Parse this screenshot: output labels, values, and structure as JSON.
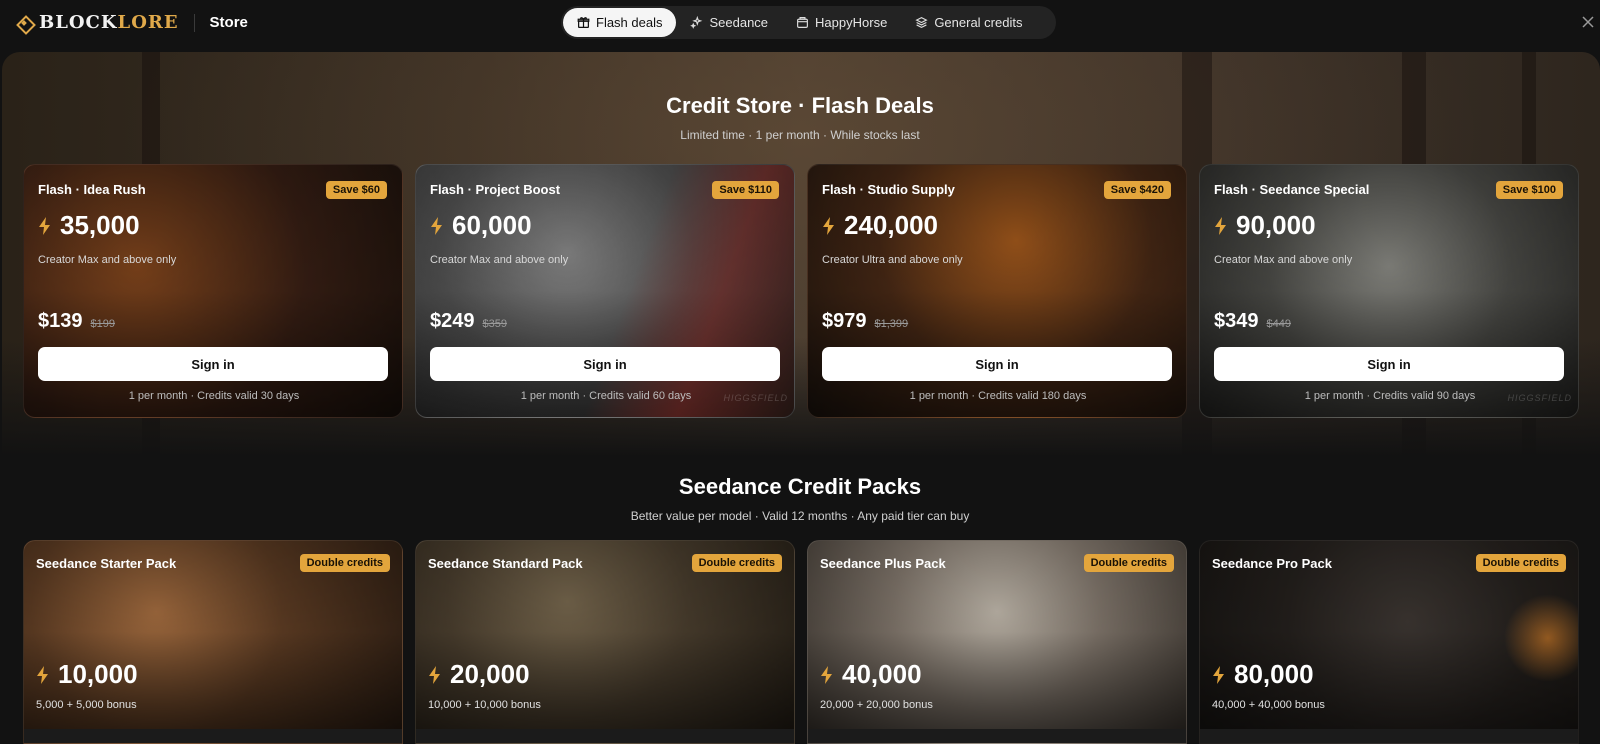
{
  "header": {
    "logo_part1": "BLOCK",
    "logo_part2": "LORE",
    "section": "Store",
    "tabs": [
      {
        "label": "Flash deals",
        "icon": "gift-icon",
        "active": true
      },
      {
        "label": "Seedance",
        "icon": "sparkle-icon",
        "active": false
      },
      {
        "label": "HappyHorse",
        "icon": "box-icon",
        "active": false
      },
      {
        "label": "General credits",
        "icon": "layers-icon",
        "active": false
      }
    ]
  },
  "flash_section": {
    "title": "Credit Store · Flash Deals",
    "subtitle": "Limited time · 1 per month · While stocks last",
    "cards": [
      {
        "name": "Flash · Idea Rush",
        "badge": "Save $60",
        "credits": "35,000",
        "eligibility": "Creator Max and above only",
        "price": "$139",
        "old_price": "$199",
        "button": "Sign in",
        "terms": "1 per month · Credits valid 30 days",
        "watermark": ""
      },
      {
        "name": "Flash · Project Boost",
        "badge": "Save $110",
        "credits": "60,000",
        "eligibility": "Creator Max and above only",
        "price": "$249",
        "old_price": "$359",
        "button": "Sign in",
        "terms": "1 per month · Credits valid 60 days",
        "watermark": "HIGGSFIELD"
      },
      {
        "name": "Flash · Studio Supply",
        "badge": "Save $420",
        "credits": "240,000",
        "eligibility": "Creator Ultra and above only",
        "price": "$979",
        "old_price": "$1,399",
        "button": "Sign in",
        "terms": "1 per month · Credits valid 180 days",
        "watermark": ""
      },
      {
        "name": "Flash · Seedance Special",
        "badge": "Save $100",
        "credits": "90,000",
        "eligibility": "Creator Max and above only",
        "price": "$349",
        "old_price": "$449",
        "button": "Sign in",
        "terms": "1 per month · Credits valid 90 days",
        "watermark": "HIGGSFIELD"
      }
    ]
  },
  "packs_section": {
    "title": "Seedance Credit Packs",
    "subtitle": "Better value per model · Valid 12 months · Any paid tier can buy",
    "cards": [
      {
        "name": "Seedance Starter Pack",
        "badge": "Double credits",
        "credits": "10,000",
        "bonus": "5,000 + 5,000 bonus"
      },
      {
        "name": "Seedance Standard Pack",
        "badge": "Double credits",
        "credits": "20,000",
        "bonus": "10,000 + 10,000 bonus"
      },
      {
        "name": "Seedance Plus Pack",
        "badge": "Double credits",
        "credits": "40,000",
        "bonus": "20,000 + 20,000 bonus"
      },
      {
        "name": "Seedance Pro Pack",
        "badge": "Double credits",
        "credits": "80,000",
        "bonus": "40,000 + 40,000 bonus"
      }
    ]
  },
  "colors": {
    "accent": "#e3a53c",
    "background": "#121212",
    "logo_gold": "#e0a94a"
  }
}
